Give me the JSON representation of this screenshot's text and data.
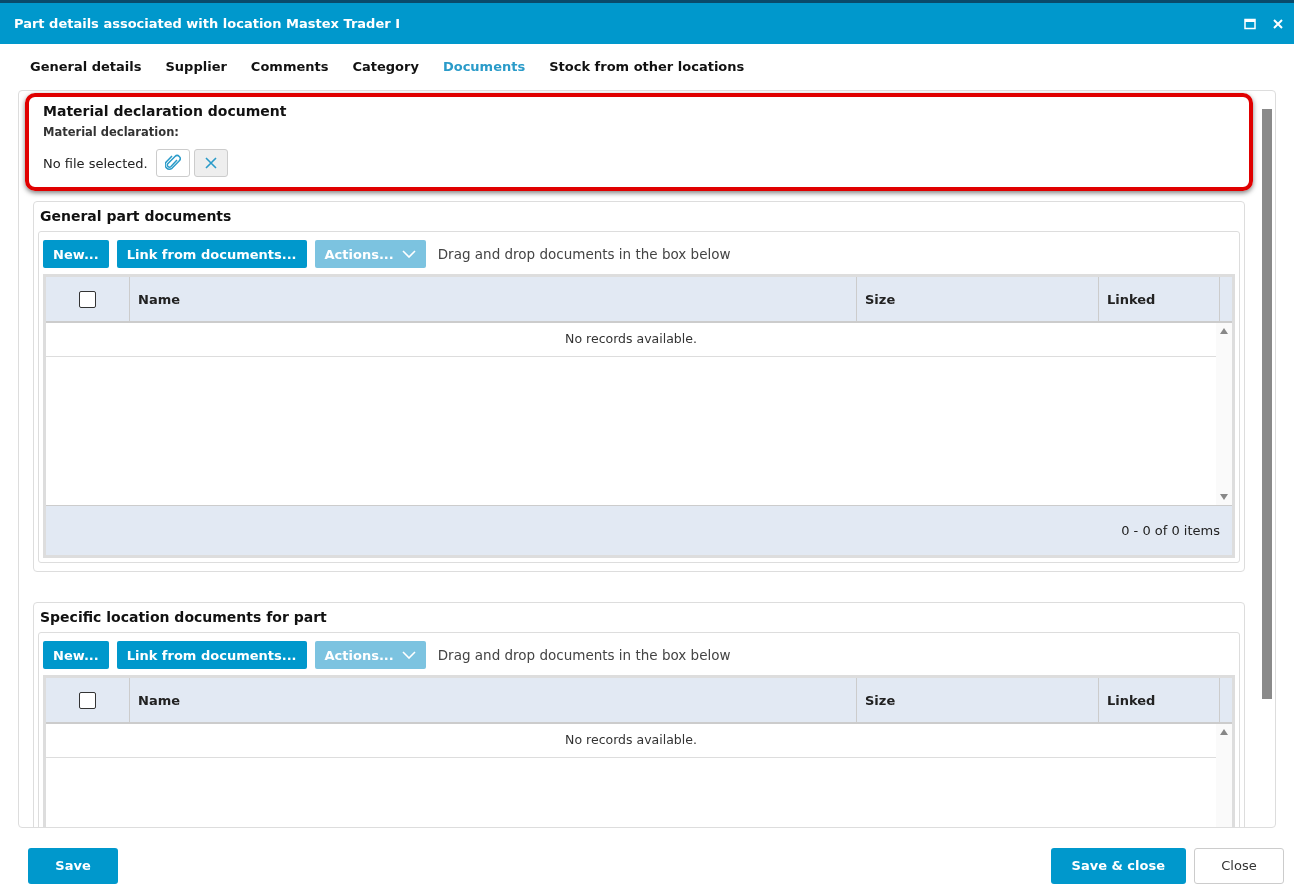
{
  "window": {
    "title": "Part details associated with location Mastex Trader I"
  },
  "tabs": [
    {
      "label": "General details",
      "selected": false
    },
    {
      "label": "Supplier",
      "selected": false
    },
    {
      "label": "Comments",
      "selected": false
    },
    {
      "label": "Category",
      "selected": false
    },
    {
      "label": "Documents",
      "selected": true
    },
    {
      "label": "Stock from other locations",
      "selected": false
    }
  ],
  "material_declaration": {
    "title": "Material declaration document",
    "label": "Material declaration:",
    "file_status": "No file selected.",
    "highlighted": true
  },
  "document_sections": [
    {
      "title": "General part documents",
      "buttons": [
        {
          "label": "New...",
          "disabled": false,
          "kind": "plain"
        },
        {
          "label": "Link from documents...",
          "disabled": false,
          "kind": "plain"
        },
        {
          "label": "Actions...",
          "disabled": true,
          "kind": "dropdown"
        }
      ],
      "hint": "Drag and drop documents in the box below",
      "select_all_checked": false,
      "columns": [
        "Name",
        "Size",
        "Linked"
      ],
      "empty_message": "No records available.",
      "pager": "0 - 0 of 0 items"
    },
    {
      "title": "Specific location documents for part",
      "buttons": [
        {
          "label": "New...",
          "disabled": false,
          "kind": "plain"
        },
        {
          "label": "Link from documents...",
          "disabled": false,
          "kind": "plain"
        },
        {
          "label": "Actions...",
          "disabled": true,
          "kind": "dropdown"
        }
      ],
      "hint": "Drag and drop documents in the box below",
      "select_all_checked": false,
      "columns": [
        "Name",
        "Size",
        "Linked"
      ],
      "empty_message": "No records available."
    }
  ],
  "footer": {
    "left_buttons": [
      {
        "label": "Save",
        "kind": "primary"
      }
    ],
    "right_buttons": [
      {
        "label": "Save & close",
        "kind": "primary"
      },
      {
        "label": "Close",
        "kind": "secondary"
      }
    ]
  }
}
